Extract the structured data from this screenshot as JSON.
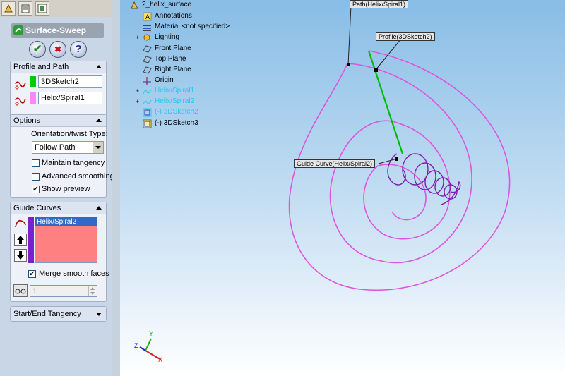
{
  "feature_manager": {
    "title": "Surface-Sweep",
    "ok_label": "✔",
    "cancel_label": "✖",
    "help_label": "?"
  },
  "profile_and_path": {
    "header": "Profile and Path",
    "profile_value": "3DSketch2",
    "path_value": "Helix/Spiral1",
    "profile_color": "#00cc00",
    "path_color": "#ff88ff"
  },
  "options": {
    "header": "Options",
    "orientation_label": "Orientation/twist Type:",
    "orientation_value": "Follow Path",
    "maintain_tangency_label": "Maintain tangency",
    "maintain_tangency_checked": false,
    "advanced_smoothing_label": "Advanced smoothing",
    "advanced_smoothing_checked": false,
    "show_preview_label": "Show preview",
    "show_preview_checked": true
  },
  "guide_curves": {
    "header": "Guide Curves",
    "items": [
      "Helix/Spiral2"
    ],
    "list_color": "#ff8080",
    "bar_color": "#7722cc",
    "merge_smooth_faces_label": "Merge smooth faces",
    "merge_smooth_faces_checked": true,
    "spin_value": "1"
  },
  "start_end_tangency": {
    "header": "Start/End Tangency"
  },
  "tree": {
    "root": "2_helix_surface",
    "items": [
      {
        "label": "Annotations"
      },
      {
        "label": "Material <not specified>"
      },
      {
        "label": "Lighting"
      },
      {
        "label": "Front Plane"
      },
      {
        "label": "Top Plane"
      },
      {
        "label": "Right Plane"
      },
      {
        "label": "Origin"
      },
      {
        "label": "Helix/Spiral1"
      },
      {
        "label": "Helix/Spiral2"
      },
      {
        "label": "(-) 3DSketch2"
      },
      {
        "label": "(-) 3DSketch3"
      }
    ]
  },
  "callouts": {
    "path": "Path(Helix/Spiral1)",
    "profile": "Profile(3DSketch2)",
    "guide": "Guide Curve(Helix/Spiral2)"
  },
  "triad": {
    "x": "X",
    "y": "Y",
    "z": "Z"
  }
}
